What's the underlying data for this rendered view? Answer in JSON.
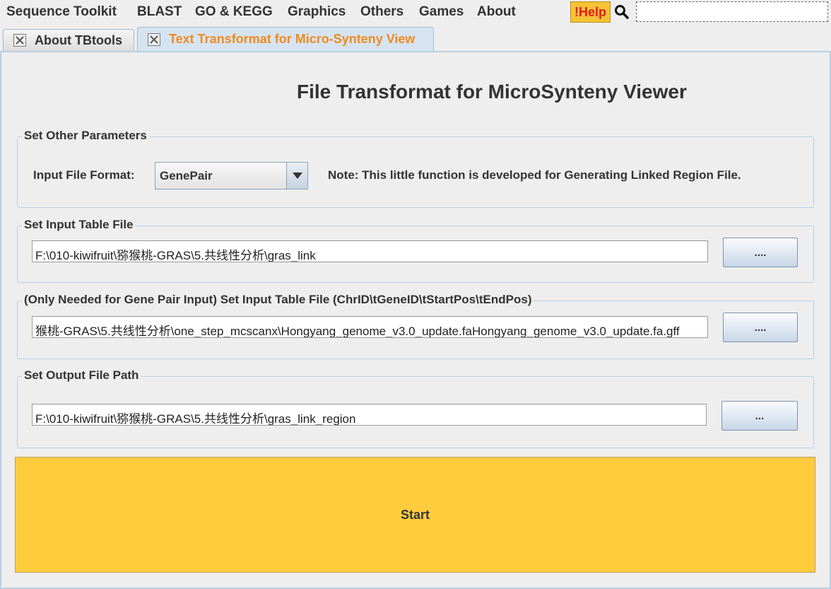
{
  "menubar": {
    "items": [
      "Sequence Toolkit",
      "BLAST",
      "GO & KEGG",
      "Graphics",
      "Others",
      "Games",
      "About"
    ],
    "help_label": "!Help",
    "search_icon": "search-icon"
  },
  "tabs": [
    {
      "label": "About TBtools",
      "active": false
    },
    {
      "label": "Text Transformat for Micro-Synteny View",
      "active": true
    }
  ],
  "page_title": "File Transformat for MicroSynteny Viewer",
  "other_params": {
    "group_title": "Set Other Parameters",
    "format_label": "Input File Format:",
    "format_value": "GenePair",
    "note": "Note: This little function is developed for Generating Linked Region File."
  },
  "input_table": {
    "group_title": "Set Input Table File",
    "path": "F:\\010-kiwifruit\\猕猴桃-GRAS\\5.共线性分析\\gras_link",
    "browse_label": "...."
  },
  "gene_pair_table": {
    "group_title": "(Only Needed for Gene Pair Input) Set Input Table File (ChrID\\tGeneID\\tStartPos\\tEndPos)",
    "path": "猴桃-GRAS\\5.共线性分析\\one_step_mcscanx\\Hongyang_genome_v3.0_update.faHongyang_genome_v3.0_update.fa.gff",
    "browse_label": "...."
  },
  "output": {
    "group_title": "Set Output File Path",
    "path": "F:\\010-kiwifruit\\猕猴桃-GRAS\\5.共线性分析\\gras_link_region",
    "browse_label": "..."
  },
  "start_label": "Start",
  "colors": {
    "help_bg": "#f6c236",
    "help_text": "#e41b1b",
    "active_tab_text": "#f08a1d",
    "start_bg": "#ffcc3d"
  }
}
